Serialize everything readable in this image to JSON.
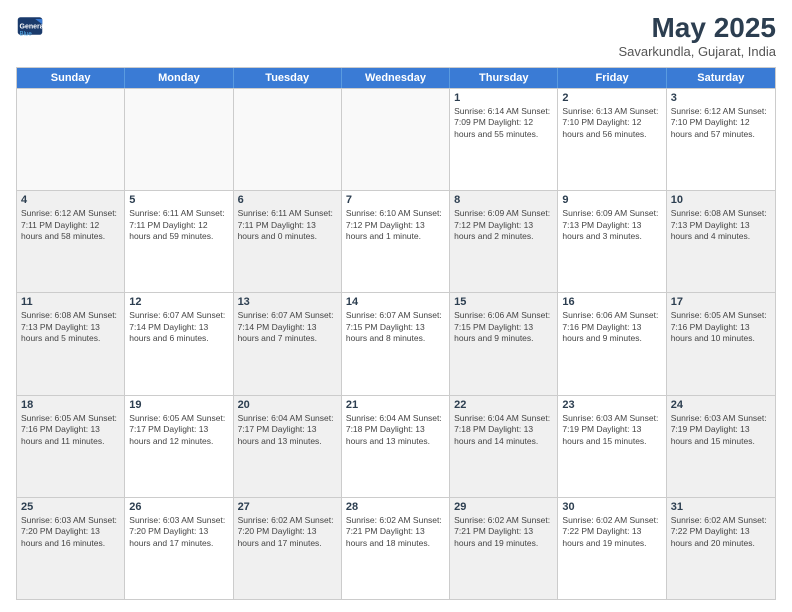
{
  "logo": {
    "line1": "General",
    "line2": "Blue"
  },
  "title": "May 2025",
  "subtitle": "Savarkundla, Gujarat, India",
  "days": [
    "Sunday",
    "Monday",
    "Tuesday",
    "Wednesday",
    "Thursday",
    "Friday",
    "Saturday"
  ],
  "rows": [
    [
      {
        "day": "",
        "info": "",
        "empty": true
      },
      {
        "day": "",
        "info": "",
        "empty": true
      },
      {
        "day": "",
        "info": "",
        "empty": true
      },
      {
        "day": "",
        "info": "",
        "empty": true
      },
      {
        "day": "1",
        "info": "Sunrise: 6:14 AM\nSunset: 7:09 PM\nDaylight: 12 hours\nand 55 minutes."
      },
      {
        "day": "2",
        "info": "Sunrise: 6:13 AM\nSunset: 7:10 PM\nDaylight: 12 hours\nand 56 minutes."
      },
      {
        "day": "3",
        "info": "Sunrise: 6:12 AM\nSunset: 7:10 PM\nDaylight: 12 hours\nand 57 minutes."
      }
    ],
    [
      {
        "day": "4",
        "info": "Sunrise: 6:12 AM\nSunset: 7:11 PM\nDaylight: 12 hours\nand 58 minutes.",
        "shaded": true
      },
      {
        "day": "5",
        "info": "Sunrise: 6:11 AM\nSunset: 7:11 PM\nDaylight: 12 hours\nand 59 minutes."
      },
      {
        "day": "6",
        "info": "Sunrise: 6:11 AM\nSunset: 7:11 PM\nDaylight: 13 hours\nand 0 minutes.",
        "shaded": true
      },
      {
        "day": "7",
        "info": "Sunrise: 6:10 AM\nSunset: 7:12 PM\nDaylight: 13 hours\nand 1 minute."
      },
      {
        "day": "8",
        "info": "Sunrise: 6:09 AM\nSunset: 7:12 PM\nDaylight: 13 hours\nand 2 minutes.",
        "shaded": true
      },
      {
        "day": "9",
        "info": "Sunrise: 6:09 AM\nSunset: 7:13 PM\nDaylight: 13 hours\nand 3 minutes."
      },
      {
        "day": "10",
        "info": "Sunrise: 6:08 AM\nSunset: 7:13 PM\nDaylight: 13 hours\nand 4 minutes.",
        "shaded": true
      }
    ],
    [
      {
        "day": "11",
        "info": "Sunrise: 6:08 AM\nSunset: 7:13 PM\nDaylight: 13 hours\nand 5 minutes.",
        "shaded": true
      },
      {
        "day": "12",
        "info": "Sunrise: 6:07 AM\nSunset: 7:14 PM\nDaylight: 13 hours\nand 6 minutes."
      },
      {
        "day": "13",
        "info": "Sunrise: 6:07 AM\nSunset: 7:14 PM\nDaylight: 13 hours\nand 7 minutes.",
        "shaded": true
      },
      {
        "day": "14",
        "info": "Sunrise: 6:07 AM\nSunset: 7:15 PM\nDaylight: 13 hours\nand 8 minutes."
      },
      {
        "day": "15",
        "info": "Sunrise: 6:06 AM\nSunset: 7:15 PM\nDaylight: 13 hours\nand 9 minutes.",
        "shaded": true
      },
      {
        "day": "16",
        "info": "Sunrise: 6:06 AM\nSunset: 7:16 PM\nDaylight: 13 hours\nand 9 minutes."
      },
      {
        "day": "17",
        "info": "Sunrise: 6:05 AM\nSunset: 7:16 PM\nDaylight: 13 hours\nand 10 minutes.",
        "shaded": true
      }
    ],
    [
      {
        "day": "18",
        "info": "Sunrise: 6:05 AM\nSunset: 7:16 PM\nDaylight: 13 hours\nand 11 minutes.",
        "shaded": true
      },
      {
        "day": "19",
        "info": "Sunrise: 6:05 AM\nSunset: 7:17 PM\nDaylight: 13 hours\nand 12 minutes."
      },
      {
        "day": "20",
        "info": "Sunrise: 6:04 AM\nSunset: 7:17 PM\nDaylight: 13 hours\nand 13 minutes.",
        "shaded": true
      },
      {
        "day": "21",
        "info": "Sunrise: 6:04 AM\nSunset: 7:18 PM\nDaylight: 13 hours\nand 13 minutes."
      },
      {
        "day": "22",
        "info": "Sunrise: 6:04 AM\nSunset: 7:18 PM\nDaylight: 13 hours\nand 14 minutes.",
        "shaded": true
      },
      {
        "day": "23",
        "info": "Sunrise: 6:03 AM\nSunset: 7:19 PM\nDaylight: 13 hours\nand 15 minutes."
      },
      {
        "day": "24",
        "info": "Sunrise: 6:03 AM\nSunset: 7:19 PM\nDaylight: 13 hours\nand 15 minutes.",
        "shaded": true
      }
    ],
    [
      {
        "day": "25",
        "info": "Sunrise: 6:03 AM\nSunset: 7:20 PM\nDaylight: 13 hours\nand 16 minutes.",
        "shaded": true
      },
      {
        "day": "26",
        "info": "Sunrise: 6:03 AM\nSunset: 7:20 PM\nDaylight: 13 hours\nand 17 minutes."
      },
      {
        "day": "27",
        "info": "Sunrise: 6:02 AM\nSunset: 7:20 PM\nDaylight: 13 hours\nand 17 minutes.",
        "shaded": true
      },
      {
        "day": "28",
        "info": "Sunrise: 6:02 AM\nSunset: 7:21 PM\nDaylight: 13 hours\nand 18 minutes."
      },
      {
        "day": "29",
        "info": "Sunrise: 6:02 AM\nSunset: 7:21 PM\nDaylight: 13 hours\nand 19 minutes.",
        "shaded": true
      },
      {
        "day": "30",
        "info": "Sunrise: 6:02 AM\nSunset: 7:22 PM\nDaylight: 13 hours\nand 19 minutes."
      },
      {
        "day": "31",
        "info": "Sunrise: 6:02 AM\nSunset: 7:22 PM\nDaylight: 13 hours\nand 20 minutes.",
        "shaded": true
      }
    ]
  ]
}
